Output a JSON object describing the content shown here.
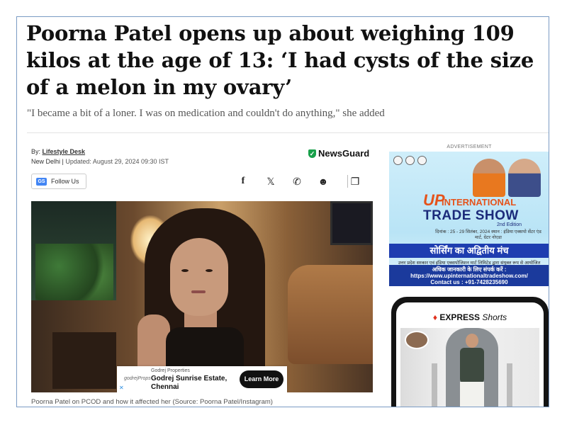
{
  "article": {
    "headline": "Poorna Patel opens up about weighing 109 kilos at the age of 13: ‘I had cysts of the size of a melon in my ovary’",
    "subhead": "\"I became a bit of a loner. I was on medication and couldn't do anything,\" she added",
    "by_prefix": "By:",
    "author": "Lifestyle Desk",
    "location": "New Delhi",
    "separator": "|",
    "updated": "Updated: August 29, 2024 09:30 IST",
    "newsguard": "NewsGuard",
    "follow_label": "Follow Us",
    "gs_icon_text": "GS",
    "caption": "Poorna Patel on PCOD and how it affected her (Source: Poorna Patel/Instagram)"
  },
  "share": {
    "facebook": "f",
    "x": "𝕏",
    "whatsapp": "✆",
    "reddit": "☻",
    "comment": "❐"
  },
  "inline_ad": {
    "logo": "godrejProps",
    "brand": "Godrej Properties",
    "title": "Godrej Sunrise Estate,",
    "city": "Chennai",
    "cta": "Learn More",
    "close": "✕"
  },
  "sidebar_ad": {
    "label": "ADVERTISEMENT",
    "up": "UP",
    "international": "INTERNATIONAL",
    "trade_show": "TRADE SHOW",
    "edition": "2nd Edition",
    "dates": "दिनांक : 25 - 29 सितंबर, 2024 स्थान : इंडिया एक्सपो सेंटर एंड मार्ट, ग्रेटर नोएडा",
    "tagline": "सोर्सिंग का अद्वितीय मंच",
    "note": "उत्तर प्रदेश सरकार एवं इंडिया एक्सपोजिशन मार्ट लिमिटेड द्वारा संयुक्त रूप से आयोजित",
    "contact_hi": "अधिक जानकारी के लिए संपर्क करें :",
    "url": "https://www.upinternationaltradeshow.com/",
    "phone": "Contact us : +91-7428235690"
  },
  "shorts": {
    "brand": "EXPRESS",
    "label": "Shorts",
    "flame": "♦"
  }
}
